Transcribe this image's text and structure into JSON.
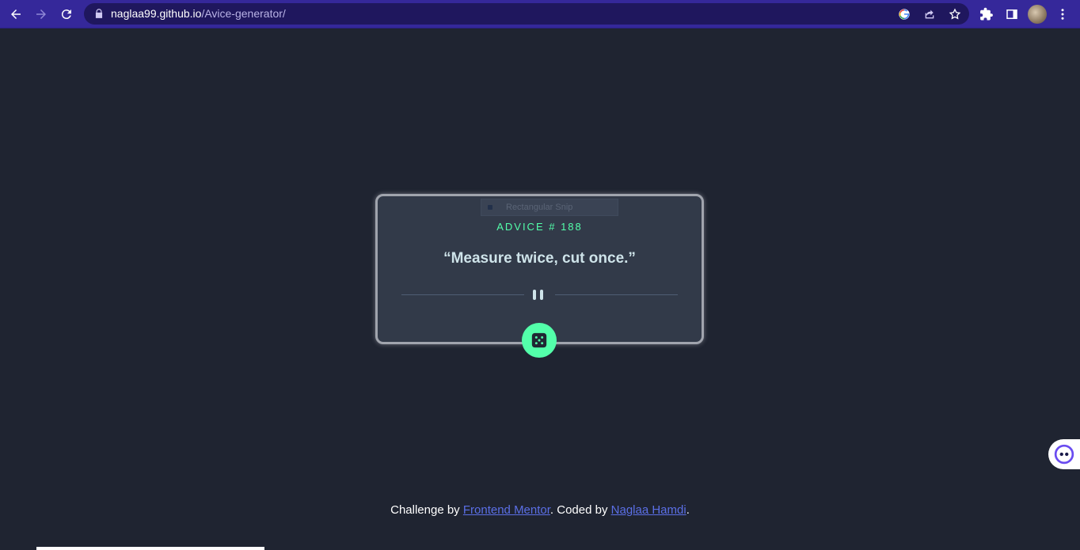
{
  "browser": {
    "url_host": "naglaa99.github.io",
    "url_path": "/Avice-generator/"
  },
  "snip_tooltip": {
    "label": "Rectangular Snip"
  },
  "advice": {
    "id_label": "ADVICE # 188",
    "quote": "“Measure twice, cut once.”"
  },
  "footer": {
    "prefix": "Challenge by ",
    "link1": "Frontend Mentor",
    "middle": ". Coded by ",
    "link2": "Naglaa Hamdi",
    "suffix": "."
  },
  "colors": {
    "page_bg": "#1f2431",
    "card_bg": "#323a49",
    "accent_green": "#53ffaa",
    "quote_text": "#cee3e9",
    "browser_chrome": "#35289a"
  }
}
